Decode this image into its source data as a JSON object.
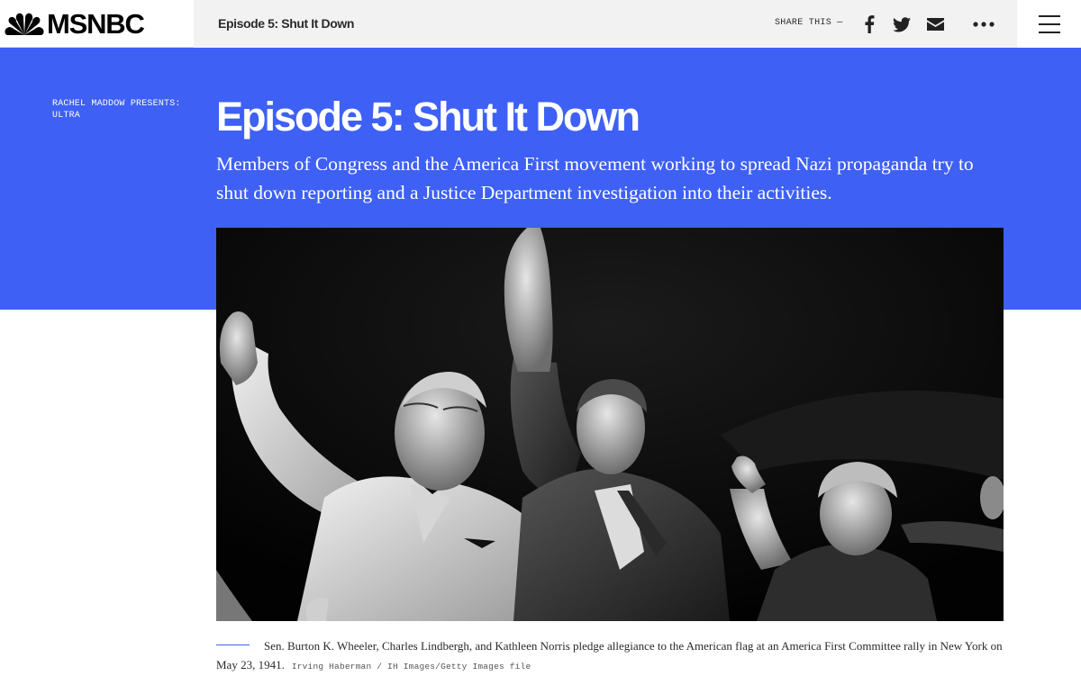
{
  "brand": {
    "name": "MSNBC",
    "logo_icon": "nbc-peacock-icon"
  },
  "header": {
    "title": "Episode 5: Shut It Down",
    "share_label": "SHARE THIS —",
    "share_icons": [
      "facebook-icon",
      "twitter-icon",
      "email-icon",
      "more-dots-icon"
    ],
    "menu_icon": "hamburger-menu-icon"
  },
  "hero": {
    "kicker": "RACHEL MADDOW PRESENTS: ULTRA",
    "headline": "Episode 5: Shut It Down",
    "dek": "Members of Congress and the America First movement working to spread Nazi propaganda try to shut down reporting and a Justice Department investigation into their activities.",
    "background_color": "#3e60f5"
  },
  "photo": {
    "caption": "Sen. Burton K. Wheeler, Charles Lindbergh, and Kathleen Norris pledge allegiance to the American flag at an America First Committee rally in New York on May 23, 1941.",
    "credit": "Irving Haberman / IH Images/Getty Images file"
  }
}
